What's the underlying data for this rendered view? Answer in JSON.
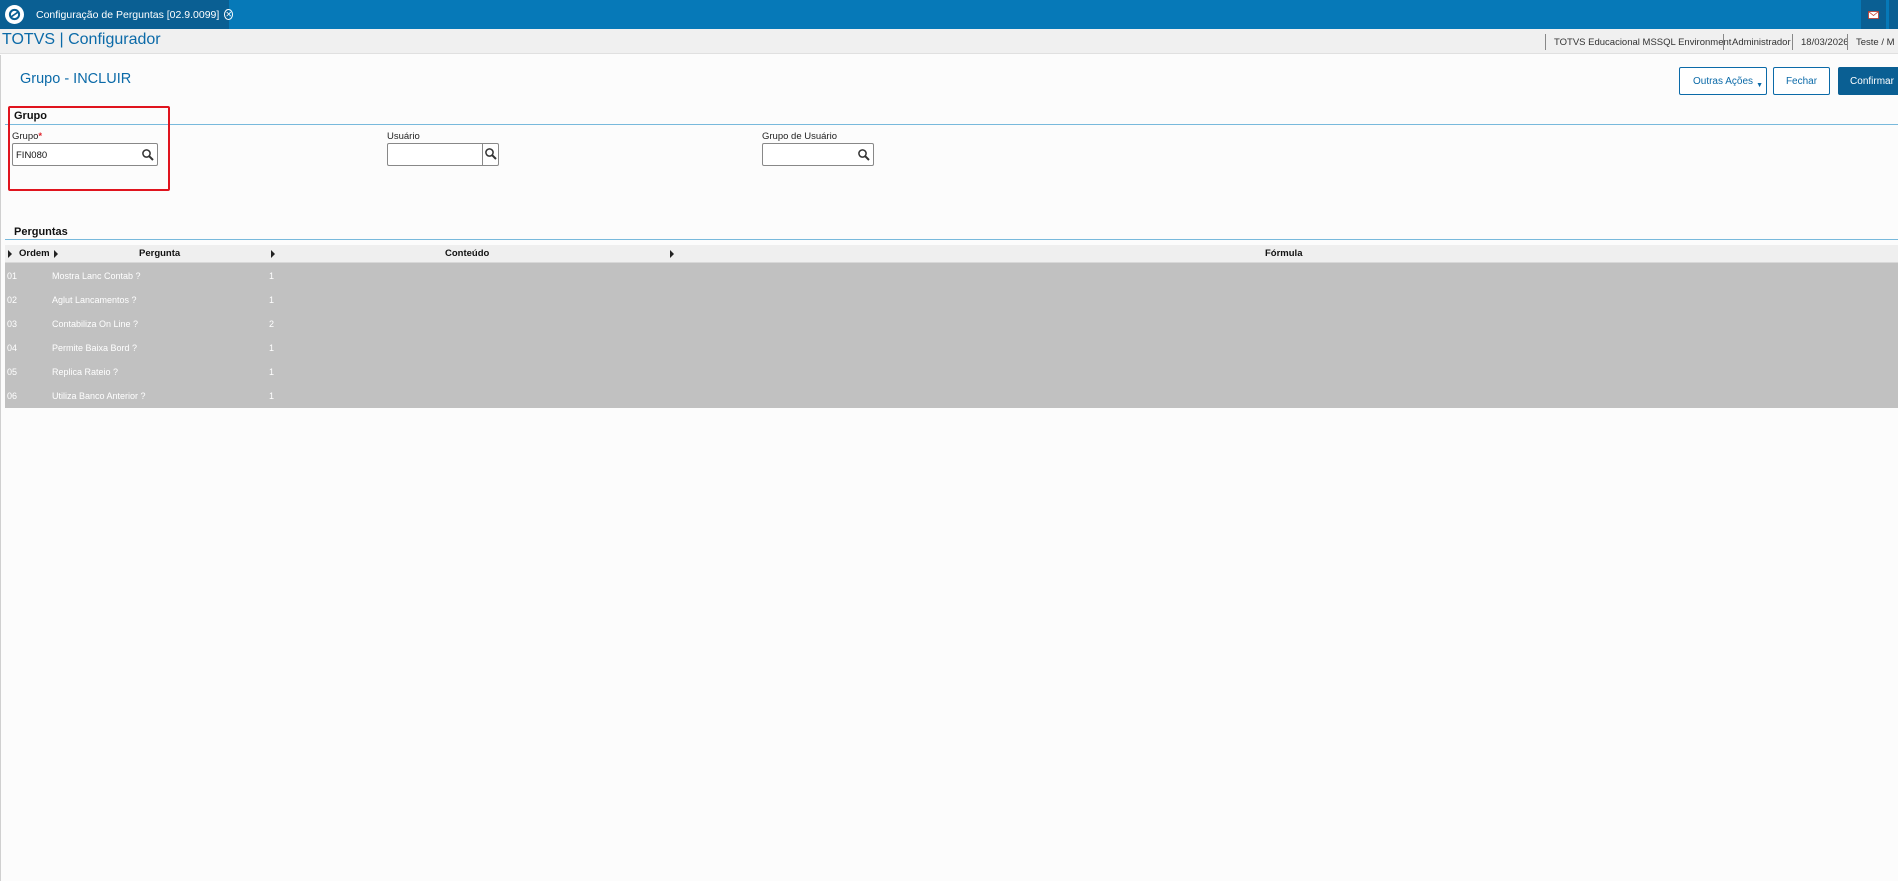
{
  "topbar": {
    "tab_title": "Configuração de Perguntas [02.9.0099]"
  },
  "appbar": {
    "title": "TOTVS | Configurador",
    "environment": "TOTVS Educacional MSSQL Environment",
    "user": "Administrador",
    "date": "18/03/2026",
    "company": "Teste / M"
  },
  "page": {
    "title": "Grupo - INCLUIR"
  },
  "actions": {
    "other_actions": "Outras Ações",
    "close": "Fechar",
    "confirm": "Confirmar"
  },
  "grupo_section": {
    "heading": "Grupo",
    "fields": {
      "grupo": {
        "label": "Grupo",
        "required": "*",
        "value": "FIN080"
      },
      "usuario": {
        "label": "Usuário",
        "value": ""
      },
      "grupo_usuario": {
        "label": "Grupo de Usuário",
        "value": ""
      }
    }
  },
  "perguntas_section": {
    "heading": "Perguntas",
    "columns": [
      "Ordem",
      "Pergunta",
      "Conteúdo",
      "Fórmula"
    ],
    "rows": [
      {
        "ordem": "01",
        "pergunta": "Mostra Lanc Contab ?",
        "conteudo": "1"
      },
      {
        "ordem": "02",
        "pergunta": "Aglut Lancamentos ?",
        "conteudo": "1"
      },
      {
        "ordem": "03",
        "pergunta": "Contabiliza On Line ?",
        "conteudo": "2"
      },
      {
        "ordem": "04",
        "pergunta": "Permite Baixa Bord ?",
        "conteudo": "1"
      },
      {
        "ordem": "05",
        "pergunta": "Replica Rateio ?",
        "conteudo": "1"
      },
      {
        "ordem": "06",
        "pergunta": "Utiliza Banco Anterior ?",
        "conteudo": "1"
      }
    ]
  },
  "colors": {
    "primary": "#0679b8",
    "dark_primary": "#0a5f93",
    "highlight": "#e0141e",
    "grid_row": "#c1c1c1"
  },
  "icons": [
    "totvs-logo-icon",
    "close-tab-icon",
    "mail-icon",
    "search-icon",
    "dropdown-caret-icon",
    "column-sort-icon"
  ]
}
